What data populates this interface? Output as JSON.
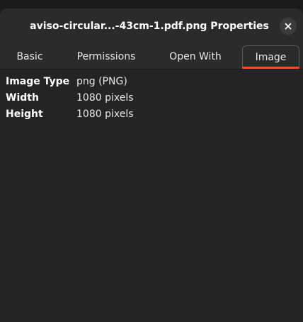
{
  "window": {
    "title": "aviso-circular...-43cm-1.pdf.png Properties",
    "close_icon": "close-icon"
  },
  "tabs": [
    {
      "label": "Basic",
      "active": false
    },
    {
      "label": "Permissions",
      "active": false
    },
    {
      "label": "Open With",
      "active": false
    },
    {
      "label": "Image",
      "active": true
    }
  ],
  "colors": {
    "accent": "#e95420",
    "background": "#242424",
    "header": "#2b2b2b"
  },
  "properties": [
    {
      "key": "Image Type",
      "value": "png (PNG)"
    },
    {
      "key": "Width",
      "value": "1080 pixels"
    },
    {
      "key": "Height",
      "value": "1080 pixels"
    }
  ]
}
